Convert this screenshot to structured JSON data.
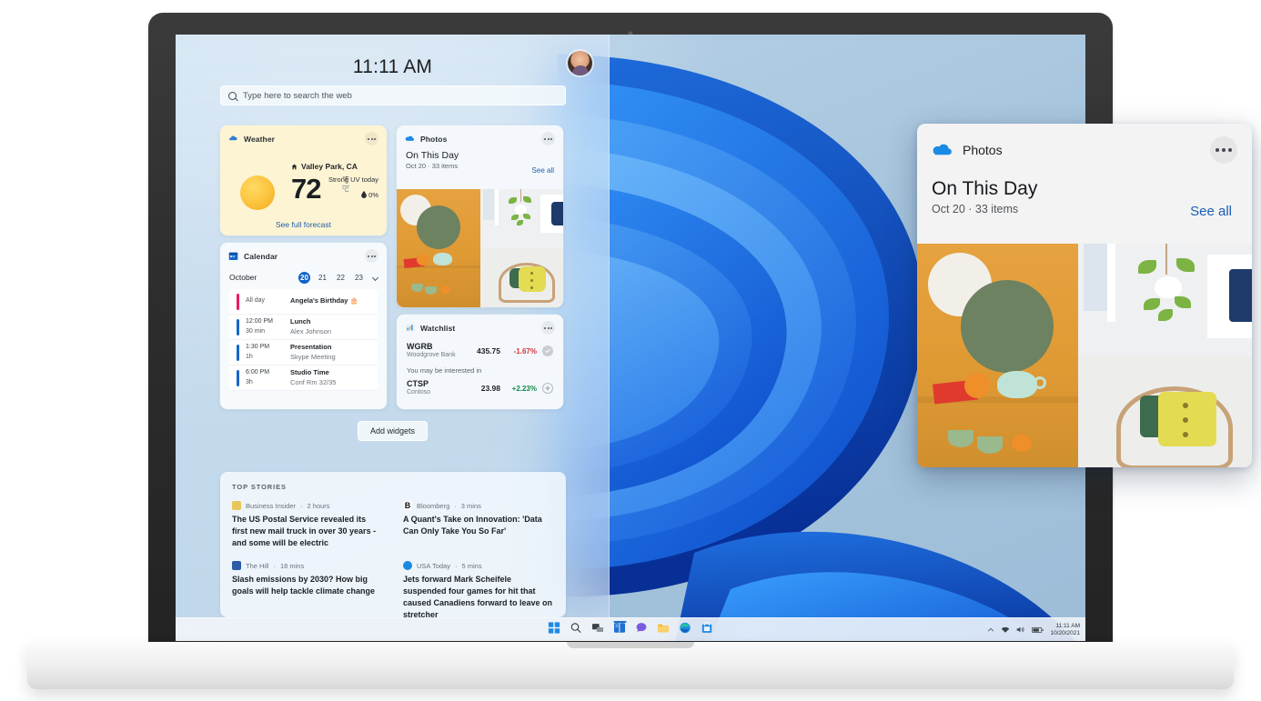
{
  "device": {
    "type": "laptop-mockup"
  },
  "widgets_panel": {
    "clock": "11:11 AM",
    "avatar_name": "user-avatar",
    "search": {
      "placeholder": "Type here to search the web",
      "icon": "search-icon"
    },
    "add_widgets_label": "Add widgets"
  },
  "weather": {
    "app": "Weather",
    "icon": "weather-cloud-icon",
    "location": "Valley Park, CA",
    "home_icon": "home-icon",
    "temperature": "72",
    "unit_primary": "°F",
    "unit_secondary": "°C",
    "uv_text": "Strong UV today",
    "precipitation": "0%",
    "precip_icon": "droplet-icon",
    "link": "See full forecast",
    "bg_color": "#fdf4d4",
    "menu_icon": "more-options-icon"
  },
  "calendar": {
    "app": "Calendar",
    "icon": "calendar-icon",
    "month": "October",
    "days": [
      "20",
      "21",
      "22",
      "23"
    ],
    "selected_day": "20",
    "chevron_icon": "chevron-down-icon",
    "events": [
      {
        "time": "All day",
        "duration": "",
        "title": "Angela's Birthday 🎂",
        "subtitle": "",
        "color": "#e81a64"
      },
      {
        "time": "12:00 PM",
        "duration": "30 min",
        "title": "Lunch",
        "subtitle": "Alex Johnson",
        "color": "#1668c7"
      },
      {
        "time": "1:30 PM",
        "duration": "1h",
        "title": "Presentation",
        "subtitle": "Skype Meeting",
        "color": "#1668c7"
      },
      {
        "time": "6:00 PM",
        "duration": "3h",
        "title": "Studio Time",
        "subtitle": "Conf Rm 32/35",
        "color": "#1668c7"
      }
    ],
    "menu_icon": "more-options-icon"
  },
  "photos_small": {
    "app": "Photos",
    "icon": "onedrive-cloud-icon",
    "title": "On This Day",
    "subtitle": "Oct 20 · 33 items",
    "see_all": "See all",
    "menu_icon": "more-options-icon"
  },
  "watchlist": {
    "app": "Watchlist",
    "icon": "chart-bar-icon",
    "note": "You may be interested in",
    "menu_icon": "more-options-icon",
    "stocks": [
      {
        "symbol": "WGRB",
        "company": "Woodgrove Bank",
        "price": "435.75",
        "change": "-1.67%",
        "direction": "down",
        "action_icon": "check-circle-icon"
      },
      {
        "symbol": "CTSP",
        "company": "Contoso",
        "price": "23.98",
        "change": "+2.23%",
        "direction": "up",
        "action_icon": "plus-circle-icon"
      }
    ],
    "down_color": "#d13438",
    "up_color": "#0f8a48"
  },
  "news": {
    "label": "TOP STORIES",
    "stories": [
      {
        "source": "Business Insider",
        "time": "2 hours",
        "headline": "The US Postal Service revealed its first new mail truck in over 30 years - and some will be electric",
        "badge_color": "#e8c65a",
        "badge_letter": ""
      },
      {
        "source": "Bloomberg",
        "time": "3 mins",
        "headline": "A Quant's Take on Innovation: 'Data Can Only Take You So Far'",
        "badge_color": "#ffffff",
        "badge_letter": "B"
      },
      {
        "source": "The Hill",
        "time": "18 mins",
        "headline": "Slash emissions by 2030? How big goals will help tackle climate change",
        "badge_color": "#2c5ba8",
        "badge_letter": ""
      },
      {
        "source": "USA Today",
        "time": "5 mins",
        "headline": "Jets forward Mark Scheifele suspended four games for hit that caused Canadiens forward to leave on stretcher",
        "badge_color": "#1a8ae0",
        "badge_letter": ""
      }
    ]
  },
  "photos_large": {
    "app": "Photos",
    "icon": "onedrive-cloud-icon",
    "title": "On This Day",
    "subtitle": "Oct 20 · 33 items",
    "see_all": "See all",
    "menu_icon": "more-options-icon"
  },
  "taskbar": {
    "items": [
      {
        "name": "start-button",
        "label": "Start"
      },
      {
        "name": "search-button",
        "label": "Search"
      },
      {
        "name": "task-view-button",
        "label": "Task view"
      },
      {
        "name": "widgets-button",
        "label": "Widgets"
      },
      {
        "name": "chat-button",
        "label": "Chat"
      },
      {
        "name": "file-explorer-button",
        "label": "File Explorer"
      },
      {
        "name": "edge-button",
        "label": "Microsoft Edge"
      },
      {
        "name": "store-button",
        "label": "Microsoft Store"
      }
    ],
    "tray": {
      "chevron_icon": "show-hidden-icons-icon",
      "network_icon": "wifi-icon",
      "volume_icon": "speaker-icon",
      "battery_icon": "battery-icon",
      "time": "11:11 AM",
      "date": "10/20/2021"
    }
  }
}
